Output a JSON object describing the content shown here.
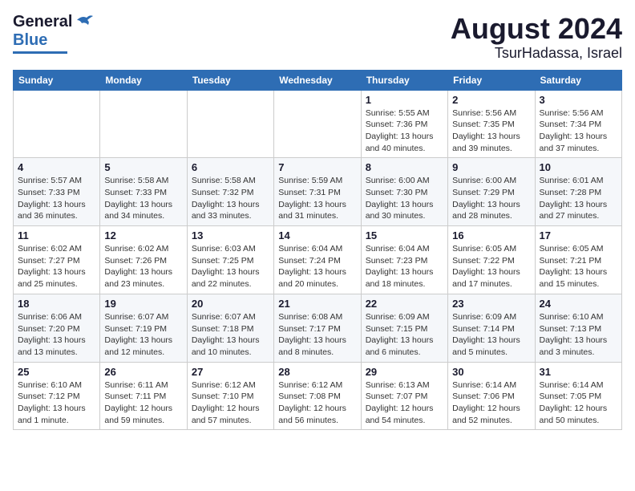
{
  "header": {
    "logo_general": "General",
    "logo_blue": "Blue",
    "title": "August 2024",
    "location": "TsurHadassa, Israel"
  },
  "calendar": {
    "days_of_week": [
      "Sunday",
      "Monday",
      "Tuesday",
      "Wednesday",
      "Thursday",
      "Friday",
      "Saturday"
    ],
    "weeks": [
      [
        {
          "day": "",
          "info": ""
        },
        {
          "day": "",
          "info": ""
        },
        {
          "day": "",
          "info": ""
        },
        {
          "day": "",
          "info": ""
        },
        {
          "day": "1",
          "info": "Sunrise: 5:55 AM\nSunset: 7:36 PM\nDaylight: 13 hours\nand 40 minutes."
        },
        {
          "day": "2",
          "info": "Sunrise: 5:56 AM\nSunset: 7:35 PM\nDaylight: 13 hours\nand 39 minutes."
        },
        {
          "day": "3",
          "info": "Sunrise: 5:56 AM\nSunset: 7:34 PM\nDaylight: 13 hours\nand 37 minutes."
        }
      ],
      [
        {
          "day": "4",
          "info": "Sunrise: 5:57 AM\nSunset: 7:33 PM\nDaylight: 13 hours\nand 36 minutes."
        },
        {
          "day": "5",
          "info": "Sunrise: 5:58 AM\nSunset: 7:33 PM\nDaylight: 13 hours\nand 34 minutes."
        },
        {
          "day": "6",
          "info": "Sunrise: 5:58 AM\nSunset: 7:32 PM\nDaylight: 13 hours\nand 33 minutes."
        },
        {
          "day": "7",
          "info": "Sunrise: 5:59 AM\nSunset: 7:31 PM\nDaylight: 13 hours\nand 31 minutes."
        },
        {
          "day": "8",
          "info": "Sunrise: 6:00 AM\nSunset: 7:30 PM\nDaylight: 13 hours\nand 30 minutes."
        },
        {
          "day": "9",
          "info": "Sunrise: 6:00 AM\nSunset: 7:29 PM\nDaylight: 13 hours\nand 28 minutes."
        },
        {
          "day": "10",
          "info": "Sunrise: 6:01 AM\nSunset: 7:28 PM\nDaylight: 13 hours\nand 27 minutes."
        }
      ],
      [
        {
          "day": "11",
          "info": "Sunrise: 6:02 AM\nSunset: 7:27 PM\nDaylight: 13 hours\nand 25 minutes."
        },
        {
          "day": "12",
          "info": "Sunrise: 6:02 AM\nSunset: 7:26 PM\nDaylight: 13 hours\nand 23 minutes."
        },
        {
          "day": "13",
          "info": "Sunrise: 6:03 AM\nSunset: 7:25 PM\nDaylight: 13 hours\nand 22 minutes."
        },
        {
          "day": "14",
          "info": "Sunrise: 6:04 AM\nSunset: 7:24 PM\nDaylight: 13 hours\nand 20 minutes."
        },
        {
          "day": "15",
          "info": "Sunrise: 6:04 AM\nSunset: 7:23 PM\nDaylight: 13 hours\nand 18 minutes."
        },
        {
          "day": "16",
          "info": "Sunrise: 6:05 AM\nSunset: 7:22 PM\nDaylight: 13 hours\nand 17 minutes."
        },
        {
          "day": "17",
          "info": "Sunrise: 6:05 AM\nSunset: 7:21 PM\nDaylight: 13 hours\nand 15 minutes."
        }
      ],
      [
        {
          "day": "18",
          "info": "Sunrise: 6:06 AM\nSunset: 7:20 PM\nDaylight: 13 hours\nand 13 minutes."
        },
        {
          "day": "19",
          "info": "Sunrise: 6:07 AM\nSunset: 7:19 PM\nDaylight: 13 hours\nand 12 minutes."
        },
        {
          "day": "20",
          "info": "Sunrise: 6:07 AM\nSunset: 7:18 PM\nDaylight: 13 hours\nand 10 minutes."
        },
        {
          "day": "21",
          "info": "Sunrise: 6:08 AM\nSunset: 7:17 PM\nDaylight: 13 hours\nand 8 minutes."
        },
        {
          "day": "22",
          "info": "Sunrise: 6:09 AM\nSunset: 7:15 PM\nDaylight: 13 hours\nand 6 minutes."
        },
        {
          "day": "23",
          "info": "Sunrise: 6:09 AM\nSunset: 7:14 PM\nDaylight: 13 hours\nand 5 minutes."
        },
        {
          "day": "24",
          "info": "Sunrise: 6:10 AM\nSunset: 7:13 PM\nDaylight: 13 hours\nand 3 minutes."
        }
      ],
      [
        {
          "day": "25",
          "info": "Sunrise: 6:10 AM\nSunset: 7:12 PM\nDaylight: 13 hours\nand 1 minute."
        },
        {
          "day": "26",
          "info": "Sunrise: 6:11 AM\nSunset: 7:11 PM\nDaylight: 12 hours\nand 59 minutes."
        },
        {
          "day": "27",
          "info": "Sunrise: 6:12 AM\nSunset: 7:10 PM\nDaylight: 12 hours\nand 57 minutes."
        },
        {
          "day": "28",
          "info": "Sunrise: 6:12 AM\nSunset: 7:08 PM\nDaylight: 12 hours\nand 56 minutes."
        },
        {
          "day": "29",
          "info": "Sunrise: 6:13 AM\nSunset: 7:07 PM\nDaylight: 12 hours\nand 54 minutes."
        },
        {
          "day": "30",
          "info": "Sunrise: 6:14 AM\nSunset: 7:06 PM\nDaylight: 12 hours\nand 52 minutes."
        },
        {
          "day": "31",
          "info": "Sunrise: 6:14 AM\nSunset: 7:05 PM\nDaylight: 12 hours\nand 50 minutes."
        }
      ]
    ]
  }
}
